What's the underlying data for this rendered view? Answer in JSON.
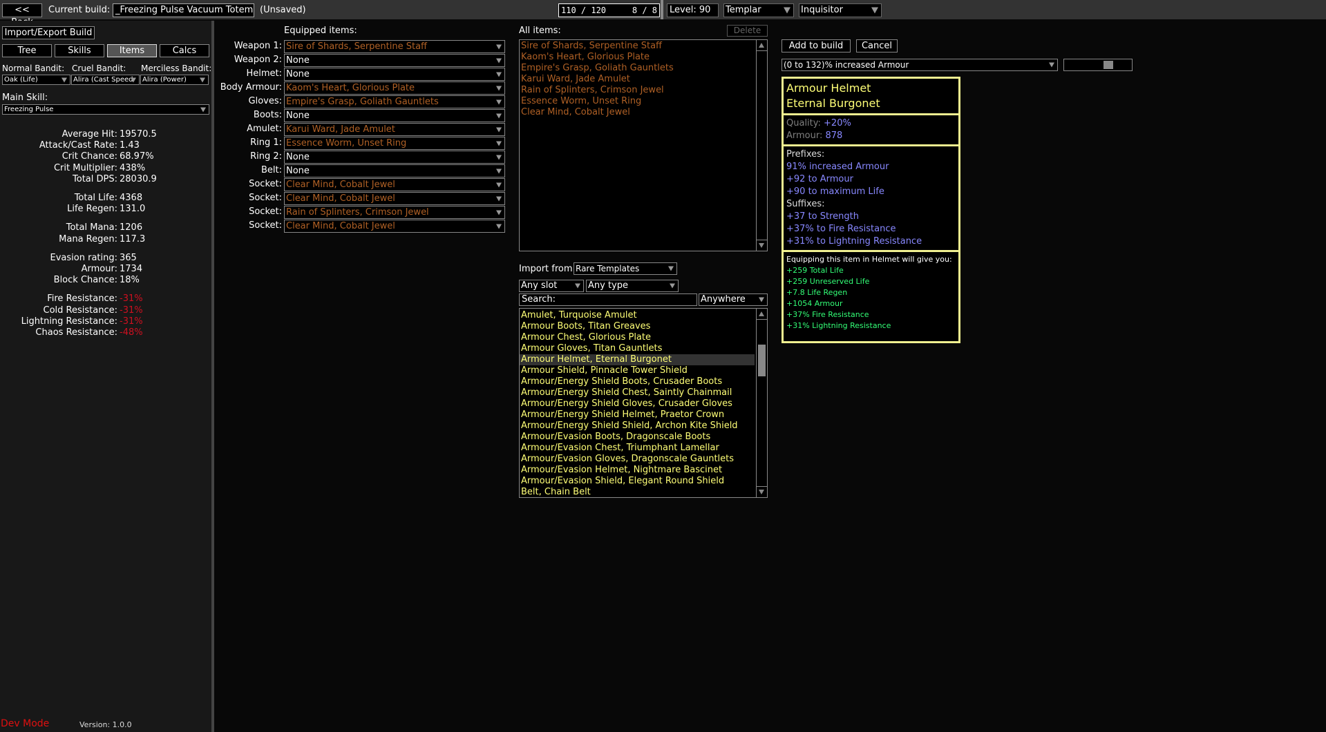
{
  "topbar": {
    "back_label": "<< Back",
    "current_build_label": "Current build:",
    "build_name": "_Freezing Pulse Vacuum Totem",
    "unsaved_label": "(Unsaved)",
    "points": "110 / 120",
    "ascendancy_points": "8 / 8",
    "level_label": "Level: 90",
    "class": "Templar",
    "ascendancy": "Inquisitor"
  },
  "left": {
    "import_export_label": "Import/Export Build",
    "tabs": [
      {
        "label": "Tree",
        "selected": false
      },
      {
        "label": "Skills",
        "selected": false
      },
      {
        "label": "Items",
        "selected": true
      },
      {
        "label": "Calcs",
        "selected": false
      }
    ],
    "bandits": [
      {
        "label": "Normal Bandit:",
        "value": "Oak (Life)"
      },
      {
        "label": "Cruel Bandit:",
        "value": "Alira (Cast Speed"
      },
      {
        "label": "Merciless Bandit:",
        "value": "Alira (Power)"
      }
    ],
    "main_skill_label": "Main Skill:",
    "main_skill": "Freezing Pulse",
    "stats": [
      {
        "label": "Average Hit:",
        "value": "19570.5"
      },
      {
        "label": "Attack/Cast Rate:",
        "value": "1.43"
      },
      {
        "label": "Crit Chance:",
        "value": "68.97%"
      },
      {
        "label": "Crit Multiplier:",
        "value": "438%"
      },
      {
        "label": "Total DPS:",
        "value": "28030.9"
      },
      {
        "label": "Total Life:",
        "value": "4368"
      },
      {
        "label": "Life Regen:",
        "value": "131.0"
      },
      {
        "label": "Total Mana:",
        "value": "1206"
      },
      {
        "label": "Mana Regen:",
        "value": "117.3"
      },
      {
        "label": "Evasion rating:",
        "value": "365"
      },
      {
        "label": "Armour:",
        "value": "1734"
      },
      {
        "label": "Block Chance:",
        "value": "18%"
      },
      {
        "label": "Fire Resistance:",
        "value": "-31%",
        "negative": true
      },
      {
        "label": "Cold Resistance:",
        "value": "-31%",
        "negative": true
      },
      {
        "label": "Lightning Resistance:",
        "value": "-31%",
        "negative": true
      },
      {
        "label": "Chaos Resistance:",
        "value": "-48%",
        "negative": true
      }
    ],
    "dev_mode_label": "Dev Mode",
    "version_label": "Version: 1.0.0"
  },
  "equipped": {
    "title": "Equipped items:",
    "slots": [
      {
        "label": "Weapon 1:",
        "value": "Sire of Shards, Serpentine Staff",
        "unique": true
      },
      {
        "label": "Weapon 2:",
        "value": "None",
        "unique": false
      },
      {
        "label": "Helmet:",
        "value": "None",
        "unique": false
      },
      {
        "label": "Body Armour:",
        "value": "Kaom's Heart, Glorious Plate",
        "unique": true
      },
      {
        "label": "Gloves:",
        "value": "Empire's Grasp, Goliath Gauntlets",
        "unique": true
      },
      {
        "label": "Boots:",
        "value": "None",
        "unique": false
      },
      {
        "label": "Amulet:",
        "value": "Karui Ward, Jade Amulet",
        "unique": true
      },
      {
        "label": "Ring 1:",
        "value": "Essence Worm, Unset Ring",
        "unique": true
      },
      {
        "label": "Ring 2:",
        "value": "None",
        "unique": false
      },
      {
        "label": "Belt:",
        "value": "None",
        "unique": false
      },
      {
        "label": "Socket:",
        "value": "Clear Mind, Cobalt Jewel",
        "unique": true
      },
      {
        "label": "Socket:",
        "value": "Clear Mind, Cobalt Jewel",
        "unique": true
      },
      {
        "label": "Socket:",
        "value": "Rain of Splinters, Crimson Jewel",
        "unique": true
      },
      {
        "label": "Socket:",
        "value": "Clear Mind, Cobalt Jewel",
        "unique": true
      }
    ]
  },
  "all_items": {
    "title": "All items:",
    "delete_label": "Delete",
    "items": [
      "Sire of Shards, Serpentine Staff",
      "Kaom's Heart, Glorious Plate",
      "Empire's Grasp, Goliath Gauntlets",
      "Karui Ward, Jade Amulet",
      "Rain of Splinters, Crimson Jewel",
      "Essence Worm, Unset Ring",
      "Clear Mind, Cobalt Jewel"
    ]
  },
  "import": {
    "label": "Import from:",
    "source": "Rare Templates",
    "slot_filter": "Any slot",
    "type_filter": "Any type",
    "search_label": "Search:",
    "search_value": "",
    "search_mode": "Anywhere",
    "templates": [
      "Amulet, Turquoise Amulet",
      "Armour Boots, Titan Greaves",
      "Armour Chest, Glorious Plate",
      "Armour Gloves, Titan Gauntlets",
      "Armour Helmet, Eternal Burgonet",
      "Armour Shield, Pinnacle Tower Shield",
      "Armour/Energy Shield Boots, Crusader Boots",
      "Armour/Energy Shield Chest, Saintly Chainmail",
      "Armour/Energy Shield Gloves, Crusader Gloves",
      "Armour/Energy Shield Helmet, Praetor Crown",
      "Armour/Energy Shield Shield, Archon Kite Shield",
      "Armour/Evasion Boots, Dragonscale Boots",
      "Armour/Evasion Chest, Triumphant Lamellar",
      "Armour/Evasion Gloves, Dragonscale Gauntlets",
      "Armour/Evasion Helmet, Nightmare Bascinet",
      "Armour/Evasion Shield, Elegant Round Shield",
      "Belt, Chain Belt"
    ],
    "selected_index": 4
  },
  "editor": {
    "add_label": "Add to build",
    "cancel_label": "Cancel",
    "mod_select": "(0 to 132)% increased Armour",
    "mod_slider_fraction": 0.69
  },
  "tooltip": {
    "title_line1": "Armour Helmet",
    "title_line2": "Eternal Burgonet",
    "props": [
      {
        "label": "Quality: ",
        "value": "+20%"
      },
      {
        "label": "Armour: ",
        "value": "878"
      }
    ],
    "prefixes_label": "Prefixes:",
    "prefixes": [
      "91% increased Armour",
      "+92 to Armour",
      "+90 to maximum Life"
    ],
    "suffixes_label": "Suffixes:",
    "suffixes": [
      "+37 to Strength",
      "+37% to Fire Resistance",
      "+31% to Lightning Resistance"
    ],
    "compare_header": "Equipping this item in Helmet will give you:",
    "compare": [
      "+259 Total Life",
      "+259 Unreserved Life",
      "+7.8 Life Regen",
      "+1054 Armour",
      "+37% Fire Resistance",
      "+31% Lightning Resistance"
    ]
  },
  "colors": {
    "unique": "#af6025",
    "rare": "#ffff77",
    "magic": "#8888ff",
    "positive": "#33ff77",
    "negative": "#d01020",
    "tooltip_border": "#f0f090"
  }
}
